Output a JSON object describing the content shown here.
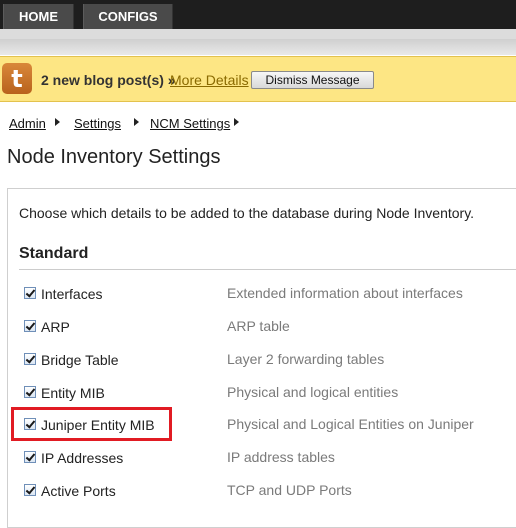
{
  "nav": {
    "tabs": [
      {
        "label": "HOME"
      },
      {
        "label": "CONFIGS"
      }
    ]
  },
  "message": {
    "logo_letter": "t",
    "text": "2 new blog post(s) »",
    "link": "More Details",
    "dismiss_label": "Dismiss Message"
  },
  "breadcrumb": [
    "Admin",
    "Settings",
    "NCM Settings"
  ],
  "page": {
    "title": "Node Inventory Settings",
    "description": "Choose which details to be added to the database during Node Inventory.",
    "section": "Standard"
  },
  "items": [
    {
      "label": "Interfaces",
      "desc": "Extended information about interfaces",
      "checked": true
    },
    {
      "label": "ARP",
      "desc": "ARP table",
      "checked": true
    },
    {
      "label": "Bridge Table",
      "desc": "Layer 2 forwarding tables",
      "checked": true
    },
    {
      "label": "Entity MIB",
      "desc": "Physical and logical entities",
      "checked": true
    },
    {
      "label": "Juniper Entity MIB",
      "desc": "Physical and Logical Entities on Juniper",
      "checked": true
    },
    {
      "label": "IP Addresses",
      "desc": "IP address tables",
      "checked": true
    },
    {
      "label": "Active Ports",
      "desc": "TCP and UDP Ports",
      "checked": true
    }
  ],
  "colors": {
    "highlight": "#e11b23",
    "message_bg": "#fde684",
    "nav_bg": "#1e1e1e"
  }
}
